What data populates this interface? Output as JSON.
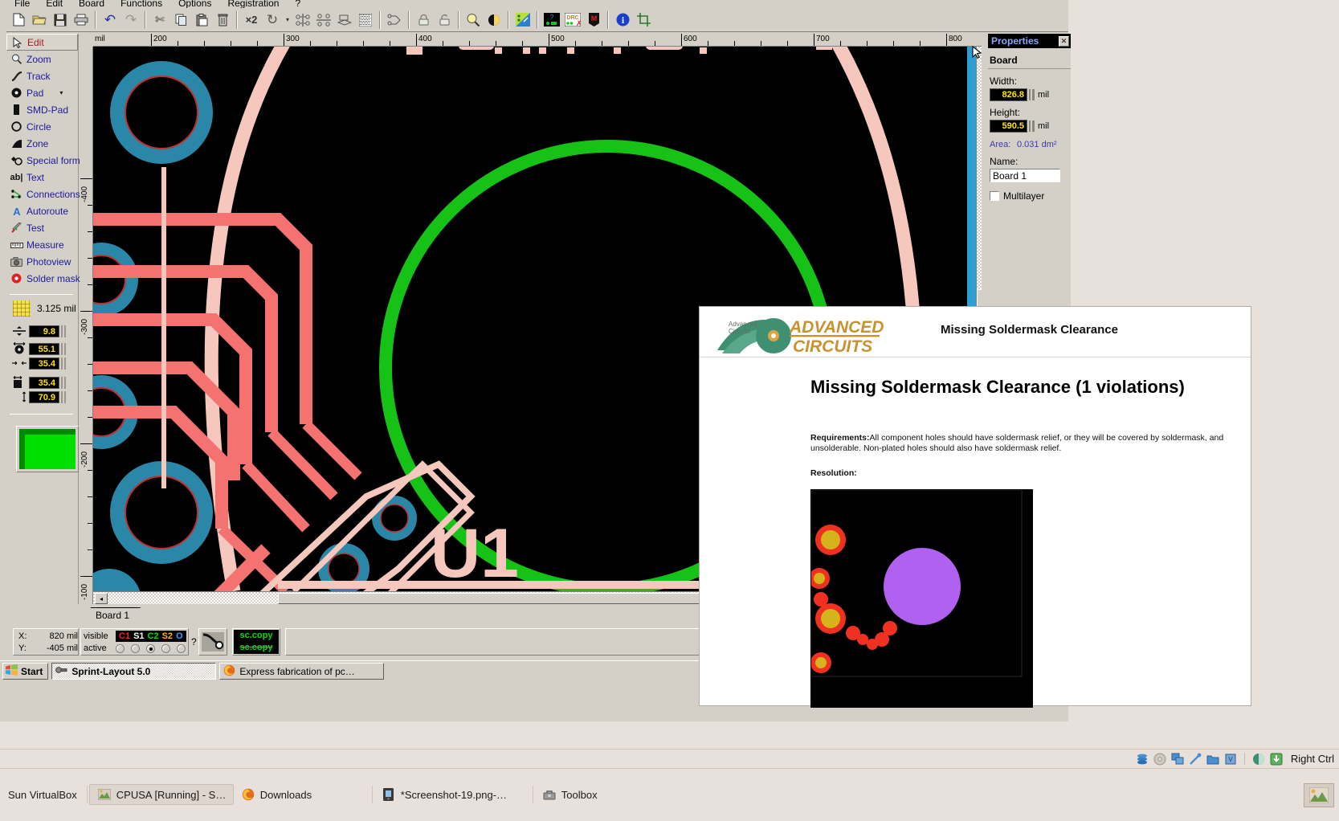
{
  "app": {
    "title": "Sprint-Layout 5.0",
    "menus": [
      "File",
      "Edit",
      "Board",
      "Functions",
      "Options",
      "Registration",
      "?"
    ],
    "toolbar": [
      {
        "name": "new-file-icon",
        "glyph": "⬜"
      },
      {
        "name": "open-folder-icon",
        "glyph": "📂"
      },
      {
        "name": "save-icon",
        "glyph": "💾"
      },
      {
        "name": "print-icon",
        "glyph": "🖨"
      },
      {
        "name": "undo-icon",
        "glyph": "↶"
      },
      {
        "name": "redo-icon",
        "glyph": "↷"
      },
      {
        "name": "cut-icon",
        "glyph": "✂"
      },
      {
        "name": "copy-icon",
        "glyph": "❐"
      },
      {
        "name": "paste-icon",
        "glyph": "📋"
      },
      {
        "name": "delete-icon",
        "glyph": "🗑"
      },
      {
        "name": "duplicate-x2-icon",
        "glyph": "×2"
      },
      {
        "name": "rotate-icon",
        "glyph": "↻"
      },
      {
        "name": "rotate-dropdown-icon",
        "glyph": "▾"
      },
      {
        "name": "mirror-horizontal-icon",
        "glyph": "⤨"
      },
      {
        "name": "mirror-vertical-icon",
        "glyph": "⤧"
      },
      {
        "name": "flip-icon",
        "glyph": "⤦"
      },
      {
        "name": "fill-pattern-icon",
        "glyph": "▓"
      },
      {
        "name": "group-icon",
        "glyph": "⧉"
      },
      {
        "name": "lock-icon",
        "glyph": "🔒"
      },
      {
        "name": "unlock-icon",
        "glyph": "🔓"
      },
      {
        "name": "zoom-icon",
        "glyph": "🔍"
      },
      {
        "name": "contrast-icon",
        "glyph": "◕"
      },
      {
        "name": "design-tools-icon",
        "glyph": "◤"
      },
      {
        "name": "help-topic-icon",
        "glyph": "?"
      },
      {
        "name": "drc-icon",
        "glyph": "DRC"
      },
      {
        "name": "macro-icon",
        "glyph": "M"
      },
      {
        "name": "info-icon",
        "glyph": "i"
      },
      {
        "name": "crop-icon",
        "glyph": "⌗"
      }
    ],
    "tools": [
      {
        "label": "Edit",
        "icon": "pointer-icon",
        "glyph": "➤",
        "selected": true
      },
      {
        "label": "Zoom",
        "icon": "magnifier-icon",
        "glyph": "🔍",
        "selected": false
      },
      {
        "label": "Track",
        "icon": "track-icon",
        "glyph": "╱",
        "selected": false
      },
      {
        "label": "Pad",
        "icon": "pad-icon",
        "glyph": "◉",
        "selected": false,
        "dropdown": "▾"
      },
      {
        "label": "SMD-Pad",
        "icon": "smd-pad-icon",
        "glyph": "▮",
        "selected": false
      },
      {
        "label": "Circle",
        "icon": "circle-icon",
        "glyph": "◯",
        "selected": false
      },
      {
        "label": "Zone",
        "icon": "zone-icon",
        "glyph": "◢",
        "selected": false
      },
      {
        "label": "Special form",
        "icon": "special-form-icon",
        "glyph": "⚜",
        "selected": false
      },
      {
        "label": "Text",
        "icon": "text-icon",
        "glyph": "ab|",
        "selected": false
      },
      {
        "label": "Connections",
        "icon": "connections-icon",
        "glyph": "∴",
        "selected": false
      },
      {
        "label": "Autoroute",
        "icon": "autoroute-icon",
        "glyph": "A",
        "selected": false
      },
      {
        "label": "Test",
        "icon": "test-probe-icon",
        "glyph": "✒",
        "selected": false
      },
      {
        "label": "Measure",
        "icon": "ruler-icon",
        "glyph": "⬚",
        "selected": false
      },
      {
        "label": "Photoview",
        "icon": "camera-icon",
        "glyph": "📷",
        "selected": false
      },
      {
        "label": "Solder mask",
        "icon": "solder-mask-icon",
        "glyph": "◉",
        "selected": false
      }
    ],
    "grid": {
      "value": "3.125 mil",
      "icon": "grid-icon"
    },
    "numeric_fields": [
      {
        "name": "track-width",
        "icon": "track-width-icon",
        "value": "9.8"
      },
      {
        "name": "pad-outer-diameter",
        "icon": "pad-size-icon",
        "value": "55.1"
      },
      {
        "name": "pad-drill-diameter",
        "icon": "pad-drill-icon",
        "value": "35.4"
      },
      {
        "name": "smd-pad-width",
        "icon": "smd-width-icon",
        "value": "35.4"
      },
      {
        "name": "smd-pad-height",
        "icon": "smd-height-icon",
        "value": "70.9"
      }
    ],
    "color_preview": {
      "name": "layer-color-preview",
      "fill": "#00e000",
      "shadow": "#008a00"
    }
  },
  "canvas": {
    "unit_label": "mil",
    "ruler_h_labels": [
      "200",
      "300",
      "400",
      "500",
      "600",
      "700",
      "800"
    ],
    "ruler_v_labels": [
      "-400",
      "-300",
      "-200",
      "-100"
    ],
    "board_label": "U1",
    "tab_label": "Board 1",
    "colors": {
      "background": "#000000",
      "track_c1": "#f4726f",
      "pad_ring": "#2b87a8",
      "silk": "#f6c7bd",
      "outline_green": "#17c217",
      "selection_blue": "#2e9fd4"
    },
    "hscroll_arrow": "◂"
  },
  "properties": {
    "panel_title": "Properties",
    "close_label": "✕",
    "section": "Board",
    "width_label": "Width:",
    "width_value": "826.8",
    "width_unit": "mil",
    "height_label": "Height:",
    "height_value": "590.5",
    "height_unit": "mil",
    "area_label": "Area:",
    "area_value": "0.031 dm²",
    "name_label": "Name:",
    "name_value": "Board 1",
    "multilayer_label": "Multilayer",
    "multilayer_checked": false
  },
  "statusbar": {
    "x_label": "X:",
    "x_value": "820 mil",
    "y_label": "Y:",
    "y_value": "-405 mil",
    "visible_label": "visible",
    "active_label": "active",
    "layers": [
      {
        "code": "C1",
        "color": "#ff2020"
      },
      {
        "code": "S1",
        "color": "#ffffff"
      },
      {
        "code": "C2",
        "color": "#00e000"
      },
      {
        "code": "S2",
        "color": "#ffb000"
      },
      {
        "code": "O",
        "color": "#3aa0ff"
      }
    ],
    "active_layer_index": 2,
    "help_mark": "?",
    "tool_icon": "probe-icon",
    "copy_button_top": "sc.copy",
    "copy_button_bottom": "sc.copy"
  },
  "guest_taskbar": {
    "start_label": "Start",
    "start_icon": "windows-flag-icon",
    "tasks": [
      {
        "label": "Sprint-Layout 5.0",
        "icon": "sprint-layout-icon",
        "active": true
      },
      {
        "label": "Express fabrication of pc…",
        "icon": "firefox-icon",
        "active": false
      }
    ]
  },
  "browser_page": {
    "logo_text_top": "ADVANCED",
    "logo_text_bottom": "CIRCUITS",
    "logo_badge_line1": "Advanced",
    "logo_badge_line2": "Circuits",
    "header_title": "Missing Soldermask Clearance",
    "heading": "Missing Soldermask Clearance (1 violations)",
    "requirements_label": "Requirements:",
    "requirements_text": "All component holes should have soldermask relief, or they will be covered by soldermask, and unsolderable. Non-plated holes should also have soldermask relief.",
    "resolution_label": "Resolution:",
    "illustration": {
      "name": "soldermask-illustration",
      "background": "#000000",
      "pad_red": "#f03020",
      "pad_gold": "#d4b41a",
      "violation_purple": "#b161ef"
    }
  },
  "host": {
    "tray_icons": [
      {
        "name": "disks-icon",
        "glyph": "☰"
      },
      {
        "name": "optical-disc-icon",
        "glyph": "◎"
      },
      {
        "name": "network-icon",
        "glyph": "⧉"
      },
      {
        "name": "usb-icon",
        "glyph": "⑂"
      },
      {
        "name": "shared-folder-icon",
        "glyph": "▰"
      },
      {
        "name": "virtualization-icon",
        "glyph": "▣"
      },
      {
        "name": "globe-icon",
        "glyph": "◔"
      },
      {
        "name": "capture-icon",
        "glyph": "⬇"
      }
    ],
    "host_key_label": "Right Ctrl",
    "taskbar_items": [
      {
        "label": "Sun VirtualBox",
        "icon": "",
        "boxed": false
      },
      {
        "label": "CPUSA [Running] - S…",
        "icon": "virtualbox-screen-icon",
        "boxed": true
      },
      {
        "label": "Downloads",
        "icon": "firefox-icon",
        "boxed": false
      },
      {
        "label": "*Screenshot-19.png-…",
        "icon": "image-viewer-icon",
        "boxed": false
      },
      {
        "label": "Toolbox",
        "icon": "toolbox-icon",
        "boxed": false
      }
    ],
    "corner_icon": "desktop-switcher-icon"
  }
}
